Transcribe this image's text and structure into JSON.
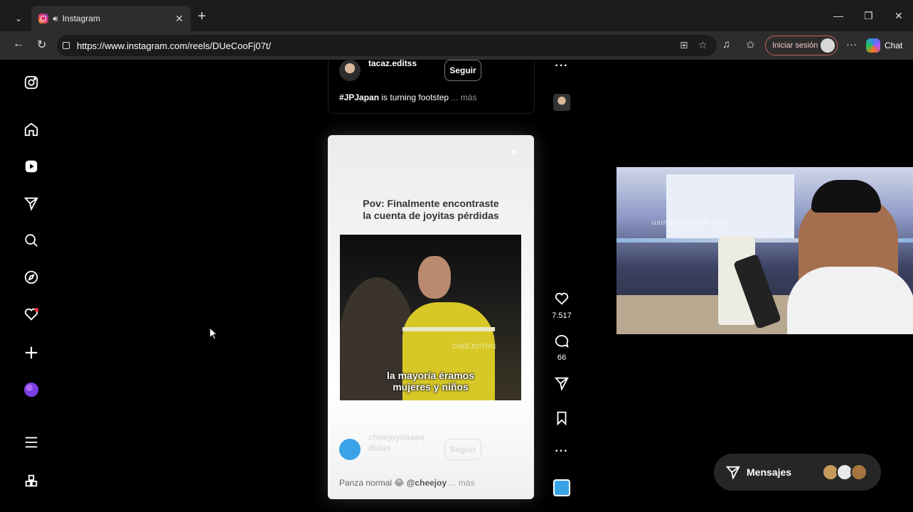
{
  "browser": {
    "tab_title": "Instagram",
    "url": "https://www.instagram.com/reels/DUeCooFj07t/",
    "signin_label": "Iniciar sesión",
    "copilot_label": "Chat"
  },
  "previous_reel": {
    "username": "tacaz.editss",
    "follow_label": "Seguir",
    "caption_tag": "#JPJapan",
    "caption_text": " is turning footstep",
    "caption_more": " ... más"
  },
  "reel": {
    "title_line1": "Pov: Finalmente encontraste",
    "title_line2": "la cuenta de joyitas pérdidas",
    "subtitle_line1": "la mayoría éramos",
    "subtitle_line2": "mujeres y niños",
    "watermark": "CHEEJOYITAS",
    "username_line1": "cheejoyitaspe",
    "username_line2": "didas",
    "follow_label": "Seguir",
    "caption_text": "Panza normal 😂 ",
    "caption_mention": "@cheejoy",
    "caption_more": " ... más"
  },
  "actions": {
    "likes": "7.517",
    "comments": "66"
  },
  "webcam": {
    "overlay_text": "using droidcam app"
  },
  "messages": {
    "label": "Mensajes"
  }
}
